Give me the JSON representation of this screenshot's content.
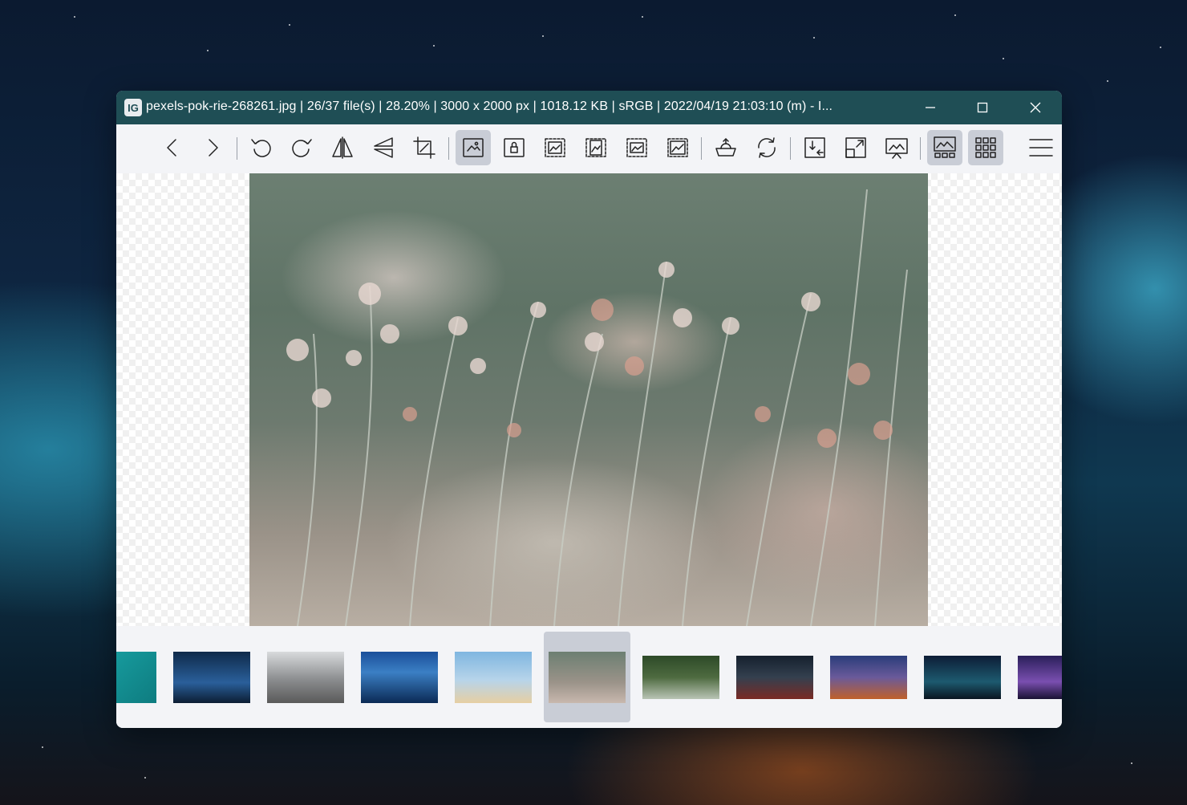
{
  "window": {
    "app_icon_glyph": "IG",
    "title": "pexels-pok-rie-268261.jpg  |  26/37 file(s)  |  28.20%  |  3000 x 2000 px  |  1018.12 KB  |  sRGB  |  2022/04/19 21:03:10 (m)  - I..."
  },
  "window_controls": [
    {
      "name": "minimize-button",
      "icon": "minimize-icon"
    },
    {
      "name": "maximize-button",
      "icon": "maximize-icon"
    },
    {
      "name": "close-button",
      "icon": "close-icon"
    }
  ],
  "toolbar": {
    "buttons": [
      {
        "name": "previous-image-button",
        "icon": "chevron-left-icon",
        "active": false
      },
      {
        "name": "next-image-button",
        "icon": "chevron-right-icon",
        "active": false
      },
      {
        "name": "rotate-left-button",
        "icon": "rotate-left-icon",
        "active": false
      },
      {
        "name": "rotate-right-button",
        "icon": "rotate-right-icon",
        "active": false
      },
      {
        "name": "flip-horizontal-button",
        "icon": "flip-horizontal-icon",
        "active": false
      },
      {
        "name": "flip-vertical-button",
        "icon": "flip-vertical-icon",
        "active": false
      },
      {
        "name": "crop-button",
        "icon": "crop-icon",
        "active": false
      },
      {
        "name": "auto-zoom-button",
        "icon": "auto-zoom-icon",
        "active": true
      },
      {
        "name": "lock-zoom-button",
        "icon": "lock-zoom-icon",
        "active": false
      },
      {
        "name": "scale-to-width-button",
        "icon": "scale-to-width-icon",
        "active": false
      },
      {
        "name": "scale-to-height-button",
        "icon": "scale-to-height-icon",
        "active": false
      },
      {
        "name": "scale-to-fit-button",
        "icon": "scale-to-fit-icon",
        "active": false
      },
      {
        "name": "scale-to-fill-button",
        "icon": "scale-to-fill-icon",
        "active": false
      },
      {
        "name": "open-with-button",
        "icon": "open-with-icon",
        "active": false
      },
      {
        "name": "refresh-button",
        "icon": "refresh-icon",
        "active": false
      },
      {
        "name": "frameless-button",
        "icon": "frameless-icon",
        "active": false
      },
      {
        "name": "full-screen-button",
        "icon": "full-screen-icon",
        "active": false
      },
      {
        "name": "slideshow-button",
        "icon": "slideshow-icon",
        "active": false
      },
      {
        "name": "toggle-thumbnail-bar-button",
        "icon": "thumbnail-bar-icon",
        "active": true
      },
      {
        "name": "toggle-gallery-button",
        "icon": "gallery-grid-icon",
        "active": true
      },
      {
        "name": "main-menu-button",
        "icon": "hamburger-menu-icon",
        "active": false
      }
    ]
  },
  "viewer": {
    "image_alt": "pexels-pok-rie-268261.jpg",
    "image_description_colors": {
      "top": "#6c7f72",
      "bottom": "#b8aea3"
    }
  },
  "filmstrip": {
    "thumbnails": [
      {
        "name": "thumbnail-1",
        "colors": [
          "#1aa6a8",
          "#0e7c80"
        ],
        "active": false,
        "partial": true
      },
      {
        "name": "thumbnail-2",
        "colors": [
          "#0f2a4a",
          "#2a5f9a"
        ],
        "active": false
      },
      {
        "name": "thumbnail-3",
        "colors": [
          "#d8dadc",
          "#5a5a5a"
        ],
        "active": false
      },
      {
        "name": "thumbnail-4",
        "colors": [
          "#1a4f9a",
          "#0b2a55"
        ],
        "active": false
      },
      {
        "name": "thumbnail-5",
        "colors": [
          "#7fb6e0",
          "#e6cfa3"
        ],
        "active": false
      },
      {
        "name": "thumbnail-6",
        "colors": [
          "#6c7f72",
          "#c8b8ae"
        ],
        "active": true
      },
      {
        "name": "thumbnail-7",
        "colors": [
          "#2d4a28",
          "#b9c4b5"
        ],
        "active": false
      },
      {
        "name": "thumbnail-8",
        "colors": [
          "#15202e",
          "#7a2a24"
        ],
        "active": false
      },
      {
        "name": "thumbnail-9",
        "colors": [
          "#2a3d7a",
          "#c0602a"
        ],
        "active": false
      },
      {
        "name": "thumbnail-10",
        "colors": [
          "#0d1d36",
          "#1d5a6f"
        ],
        "active": false
      },
      {
        "name": "thumbnail-11",
        "colors": [
          "#2a1f5a",
          "#7a4fb0"
        ],
        "active": false,
        "partial": true
      }
    ]
  }
}
